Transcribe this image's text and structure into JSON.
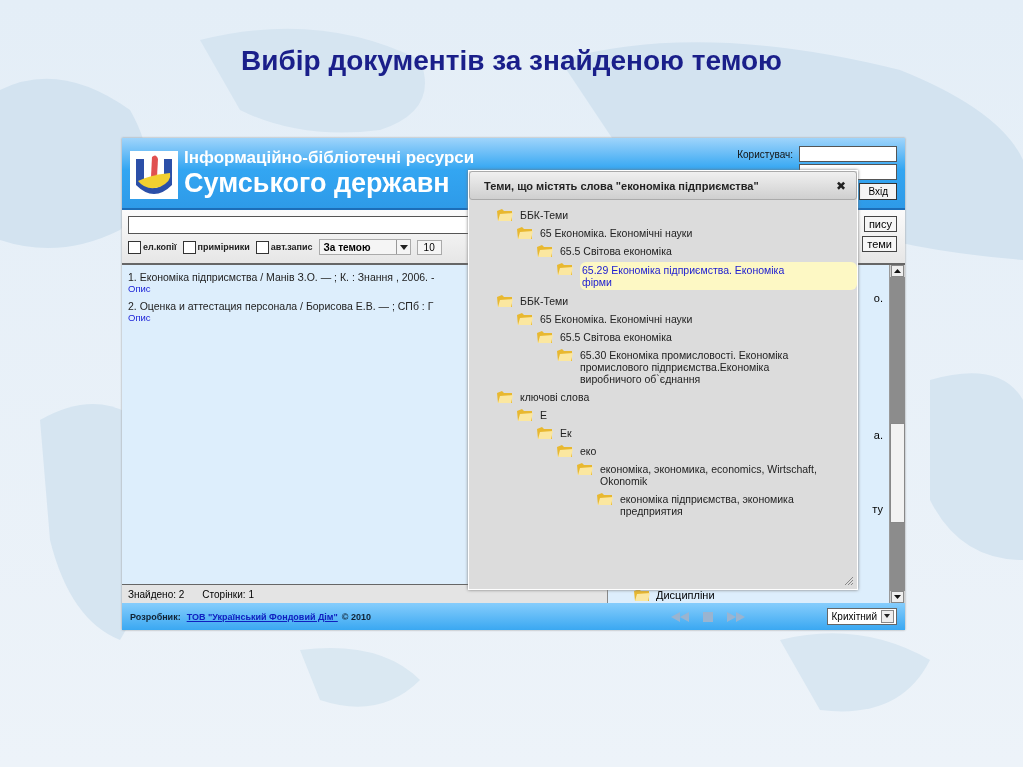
{
  "slide": {
    "title": "Вибір документів за знайденою темою"
  },
  "app": {
    "header": {
      "title_line1": "Інформаційно-бібліотечні ресурси",
      "title_line2": "Сумського державн",
      "user_label": "Користувач:",
      "login_button": "Вхід"
    },
    "toolbar": {
      "checkboxes": [
        {
          "label": "ел.копії",
          "checked": false
        },
        {
          "label": "примірники",
          "checked": false
        },
        {
          "label": "авт.запис",
          "checked": false
        }
      ],
      "search_mode": "За темою",
      "page_size": "10",
      "buttons": [
        "пису",
        "теми"
      ]
    },
    "results": [
      {
        "text": "1. Економіка підприсмства / Манів З.О. — ; К. : Знання , 2006. -",
        "link": "Опис"
      },
      {
        "text": "2. Оценка и аттестация персонала / Борисова Е.В. — ; СПб : Г",
        "link": "Опис"
      }
    ],
    "right_panel": {
      "fragments": [
        "о.",
        "а.",
        "ту"
      ],
      "folder": "Дисципліни"
    },
    "status": {
      "found": "Знайдено: 2",
      "pages": "Сторінки:  1"
    },
    "footer": {
      "developer_label": "Розробник:",
      "developer_link": "ТОВ \"Український Фондовий Дім\"",
      "copyright": "© 2010",
      "size_select": "Крихітний"
    },
    "popup": {
      "title": "Теми, що містять слова \"економіка підприємства\"",
      "close": "✖",
      "tree": [
        {
          "label": "ББК-Теми",
          "selected": false,
          "children": [
            {
              "label": "65 Економіка. Економічні науки",
              "selected": false,
              "children": [
                {
                  "label": "65.5 Світова економіка",
                  "selected": false,
                  "children": [
                    {
                      "label": "65.29 Економіка підприємства. Економіка фірми",
                      "selected": true
                    }
                  ]
                }
              ]
            }
          ]
        },
        {
          "label": "ББК-Теми",
          "selected": false,
          "children": [
            {
              "label": "65 Економіка. Економічні науки",
              "selected": false,
              "children": [
                {
                  "label": "65.5 Світова економіка",
                  "selected": false,
                  "children": [
                    {
                      "label": "65.30 Економіка промисловості. Економіка промислового підприємства.Економіка виробничого об`єднання",
                      "selected": false
                    }
                  ]
                }
              ]
            }
          ]
        },
        {
          "label": "ключові слова",
          "selected": false,
          "children": [
            {
              "label": "Е",
              "selected": false,
              "children": [
                {
                  "label": "Ек",
                  "selected": false,
                  "children": [
                    {
                      "label": "еко",
                      "selected": false,
                      "children": [
                        {
                          "label": "економіка, экономика, economics, Wirtschaft, Okonomik",
                          "selected": false,
                          "children": [
                            {
                              "label": "економіка підприємства, экономика предприятия",
                              "selected": false
                            }
                          ]
                        }
                      ]
                    }
                  ]
                }
              ]
            }
          ]
        }
      ]
    }
  }
}
